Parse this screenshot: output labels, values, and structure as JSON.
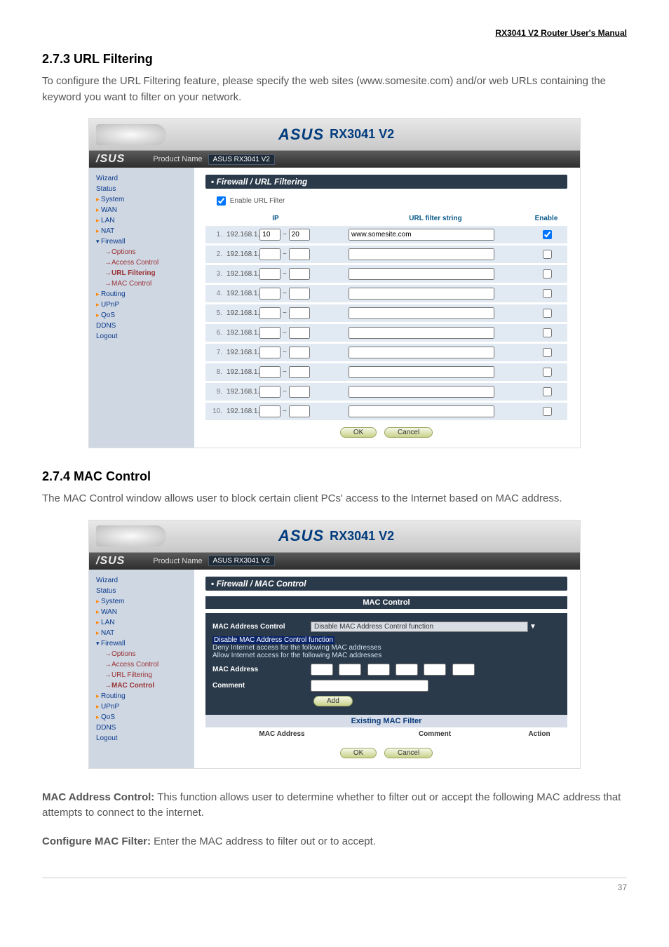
{
  "header_link": "RX3041 V2 Router User's Manual",
  "section1": {
    "heading": "2.7.3 URL Filtering",
    "para": "To configure the URL Filtering feature, please specify the web sites (www.somesite.com) and/or web URLs containing the keyword you want to filter on your network."
  },
  "screenshot_common": {
    "brand": "ASUS",
    "model_label": "RX3041 V2",
    "product_name_label": "Product Name",
    "product_name_value": "ASUS RX3041 V2"
  },
  "nav": {
    "wizard": "Wizard",
    "status": "Status",
    "system": "System",
    "wan": "WAN",
    "lan": "LAN",
    "nat": "NAT",
    "firewall": "Firewall",
    "options": "→Options",
    "access_control": "→Access Control",
    "url_filtering": "→URL Filtering",
    "mac_control": "→MAC Control",
    "routing": "Routing",
    "upnp": "UPnP",
    "qos": "QoS",
    "ddns": "DDNS",
    "logout": "Logout"
  },
  "url_panel": {
    "title": "Firewall / URL Filtering",
    "enable_label": "Enable URL Filter",
    "col_ip": "IP",
    "col_string": "URL filter string",
    "col_enable": "Enable",
    "ip_prefix": "192.168.1.",
    "rows": [
      {
        "idx": "1.",
        "from": "10",
        "to": "20",
        "str": "www.somesite.com",
        "en": true
      },
      {
        "idx": "2.",
        "from": "",
        "to": "",
        "str": "",
        "en": false
      },
      {
        "idx": "3.",
        "from": "",
        "to": "",
        "str": "",
        "en": false
      },
      {
        "idx": "4.",
        "from": "",
        "to": "",
        "str": "",
        "en": false
      },
      {
        "idx": "5.",
        "from": "",
        "to": "",
        "str": "",
        "en": false
      },
      {
        "idx": "6.",
        "from": "",
        "to": "",
        "str": "",
        "en": false
      },
      {
        "idx": "7.",
        "from": "",
        "to": "",
        "str": "",
        "en": false
      },
      {
        "idx": "8.",
        "from": "",
        "to": "",
        "str": "",
        "en": false
      },
      {
        "idx": "9.",
        "from": "",
        "to": "",
        "str": "",
        "en": false
      },
      {
        "idx": "10.",
        "from": "",
        "to": "",
        "str": "",
        "en": false
      }
    ],
    "ok": "OK",
    "cancel": "Cancel"
  },
  "section2": {
    "heading": "2.7.4 MAC Control",
    "para": "The MAC Control window allows user to block certain client PCs' access to the Internet based on MAC address."
  },
  "mac_panel": {
    "title": "Firewall / MAC Control",
    "sub": "MAC Control",
    "addr_ctrl_label": "MAC Address Control",
    "addr_ctrl_sel": "Disable MAC Address Control function",
    "opt1": "Disable MAC Address Control function",
    "opt2": "Deny Internet access for the following MAC addresses",
    "opt3": "Allow Internet access for the following MAC addresses",
    "mac_addr_label": "MAC Address",
    "comment_label": "Comment",
    "add": "Add",
    "existing": "Existing MAC Filter",
    "col_mac": "MAC Address",
    "col_comment": "Comment",
    "col_action": "Action",
    "ok": "OK",
    "cancel": "Cancel"
  },
  "body_after": {
    "mac_addr_ctrl_bold": "MAC Address Control:",
    "mac_addr_ctrl_text": " This function allows user to determine whether to filter out or accept the following MAC address that attempts to connect to the internet.",
    "conf_mac_bold": "Configure MAC Filter:",
    "conf_mac_text": " Enter the MAC address to filter out or to accept."
  },
  "page_number": "37"
}
